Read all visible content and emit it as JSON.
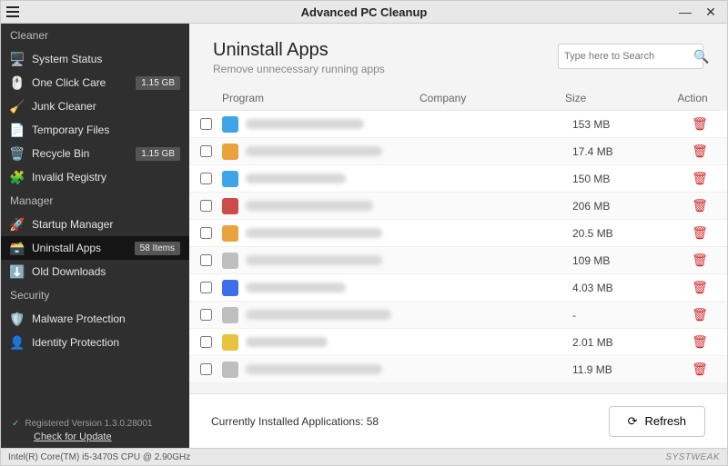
{
  "window": {
    "title": "Advanced PC Cleanup"
  },
  "sidebar": {
    "sections": {
      "cleaner": "Cleaner",
      "manager": "Manager",
      "security": "Security"
    },
    "items": {
      "system_status": {
        "label": "System Status",
        "badge": null,
        "icon_color": "#2a7fd4"
      },
      "one_click_care": {
        "label": "One Click Care",
        "badge": "1.15 GB",
        "icon_color": "#e25b2c"
      },
      "junk_cleaner": {
        "label": "Junk Cleaner",
        "badge": null,
        "icon_color": "#e8a33d"
      },
      "temporary_files": {
        "label": "Temporary Files",
        "badge": null,
        "icon_color": "#bfbfbf"
      },
      "recycle_bin": {
        "label": "Recycle Bin",
        "badge": "1.15 GB",
        "icon_color": "#bfbfbf"
      },
      "invalid_registry": {
        "label": "Invalid Registry",
        "badge": null,
        "icon_color": "#3da5e8"
      },
      "startup_manager": {
        "label": "Startup Manager",
        "badge": null,
        "icon_color": "#bfbfbf"
      },
      "uninstall_apps": {
        "label": "Uninstall Apps",
        "badge": "58 Items",
        "icon_color": "#bfbfbf"
      },
      "old_downloads": {
        "label": "Old Downloads",
        "badge": null,
        "icon_color": "#5fbf3f"
      },
      "malware_protection": {
        "label": "Malware Protection",
        "badge": null,
        "icon_color": "#3da5e8"
      },
      "identity_protection": {
        "label": "Identity Protection",
        "badge": null,
        "icon_color": "#2aa36f"
      }
    },
    "footer": {
      "registered_label": "Registered Version 1.3.0.28001",
      "check_update": "Check for Update"
    }
  },
  "main": {
    "title": "Uninstall Apps",
    "subtitle": "Remove unnecessary running apps",
    "search_placeholder": "Type here to Search",
    "columns": {
      "program": "Program",
      "company": "Company",
      "size": "Size",
      "action": "Action"
    },
    "rows": [
      {
        "icon_color": "#3da5e8",
        "prog_w": 130,
        "comp_w": 90,
        "size": "153 MB"
      },
      {
        "icon_color": "#e8a33d",
        "prog_w": 150,
        "comp_w": 150,
        "size": "17.4 MB"
      },
      {
        "icon_color": "#3da5e8",
        "prog_w": 110,
        "comp_w": 90,
        "size": "150 MB"
      },
      {
        "icon_color": "#cc4b4b",
        "prog_w": 140,
        "comp_w": 80,
        "size": "206 MB"
      },
      {
        "icon_color": "#e8a33d",
        "prog_w": 150,
        "comp_w": 80,
        "size": "20.5 MB"
      },
      {
        "icon_color": "#bfbfbf",
        "prog_w": 150,
        "comp_w": 60,
        "size": "109 MB"
      },
      {
        "icon_color": "#3d6fe8",
        "prog_w": 110,
        "comp_w": 60,
        "size": "4.03 MB"
      },
      {
        "icon_color": "#bfbfbf",
        "prog_w": 160,
        "comp_w": 110,
        "size": "-"
      },
      {
        "icon_color": "#e8c33d",
        "prog_w": 90,
        "comp_w": 60,
        "size": "2.01 MB"
      },
      {
        "icon_color": "#bfbfbf",
        "prog_w": 150,
        "comp_w": 80,
        "size": "11.9 MB"
      }
    ],
    "footer": {
      "installed_label": "Currently Installed Applications: 58",
      "refresh": "Refresh"
    }
  },
  "statusbar": {
    "cpu": "Intel(R) Core(TM) i5-3470S CPU @ 2.90GHz",
    "brand": "SYSTWEAK"
  }
}
